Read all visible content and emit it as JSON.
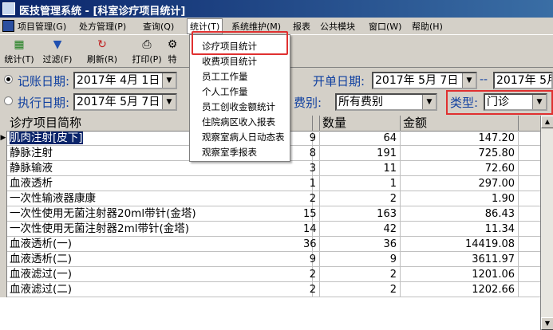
{
  "window": {
    "title": "医技管理系统 - [科室诊疗项目统计]"
  },
  "menubar": {
    "items": [
      {
        "label": "项目管理(G)"
      },
      {
        "label": "处方管理(P)"
      },
      {
        "label": "查询(Q)"
      },
      {
        "label": "统计(T)"
      },
      {
        "label": "系统维护(M)"
      },
      {
        "label": "报表"
      },
      {
        "label": "公共模块"
      },
      {
        "label": "窗口(W)"
      },
      {
        "label": "帮助(H)"
      }
    ]
  },
  "toolbar": {
    "buttons": [
      {
        "label": "统计(T)",
        "icon": "stats-icon"
      },
      {
        "label": "过滤(F)",
        "icon": "filter-icon"
      },
      {
        "label": "刷新(R)",
        "icon": "refresh-icon"
      },
      {
        "label": "打印(P)",
        "icon": "print-icon"
      },
      {
        "label": "特",
        "icon": "special-icon"
      }
    ]
  },
  "filters": {
    "record_date_label": "记账日期:",
    "record_date_from": "2017年 4月 1日",
    "open_date_label": "开单日期:",
    "open_date_from": "2017年 5月 7日",
    "open_date_to": "2017年 5月",
    "exec_date_label": "执行日期:",
    "exec_date_from": "2017年 5月 7日",
    "fee_type_label": "费别:",
    "fee_type_value": "所有费别",
    "category_label": "类型:",
    "category_value": "门诊",
    "dash": "--"
  },
  "stats_menu": {
    "items": [
      "诊疗项目统计",
      "收费项目统计",
      "员工工作量",
      "个人工作量",
      "员工创收金额统计",
      "住院病区收入报表",
      "观察室病人日动态表",
      "观察室季报表"
    ]
  },
  "table": {
    "columns": [
      "诊疗项目简称",
      "数量",
      "金额"
    ],
    "rows": [
      {
        "name": "肌肉注射[皮下]",
        "c1": "9",
        "qty": "64",
        "amount": "147.20"
      },
      {
        "name": "静脉注射",
        "c1": "8",
        "qty": "191",
        "amount": "725.80"
      },
      {
        "name": "静脉输液",
        "c1": "3",
        "qty": "11",
        "amount": "72.60"
      },
      {
        "name": "血液透析",
        "c1": "1",
        "qty": "1",
        "amount": "297.00"
      },
      {
        "name": "一次性输液器康康",
        "c1": "2",
        "qty": "2",
        "amount": "1.90"
      },
      {
        "name": "一次性使用无菌注射器20ml带针(金塔)",
        "c1": "15",
        "qty": "163",
        "amount": "86.43"
      },
      {
        "name": "一次性使用无菌注射器2ml带针(金塔)",
        "c1": "14",
        "qty": "42",
        "amount": "11.34"
      },
      {
        "name": "血液透析(一)",
        "c1": "36",
        "qty": "36",
        "amount": "14419.08"
      },
      {
        "name": "血液透析(二)",
        "c1": "9",
        "qty": "9",
        "amount": "3611.97"
      },
      {
        "name": "血液滤过(一)",
        "c1": "2",
        "qty": "2",
        "amount": "1201.06"
      },
      {
        "name": "血液滤过(二)",
        "c1": "2",
        "qty": "2",
        "amount": "1202.66"
      }
    ]
  }
}
